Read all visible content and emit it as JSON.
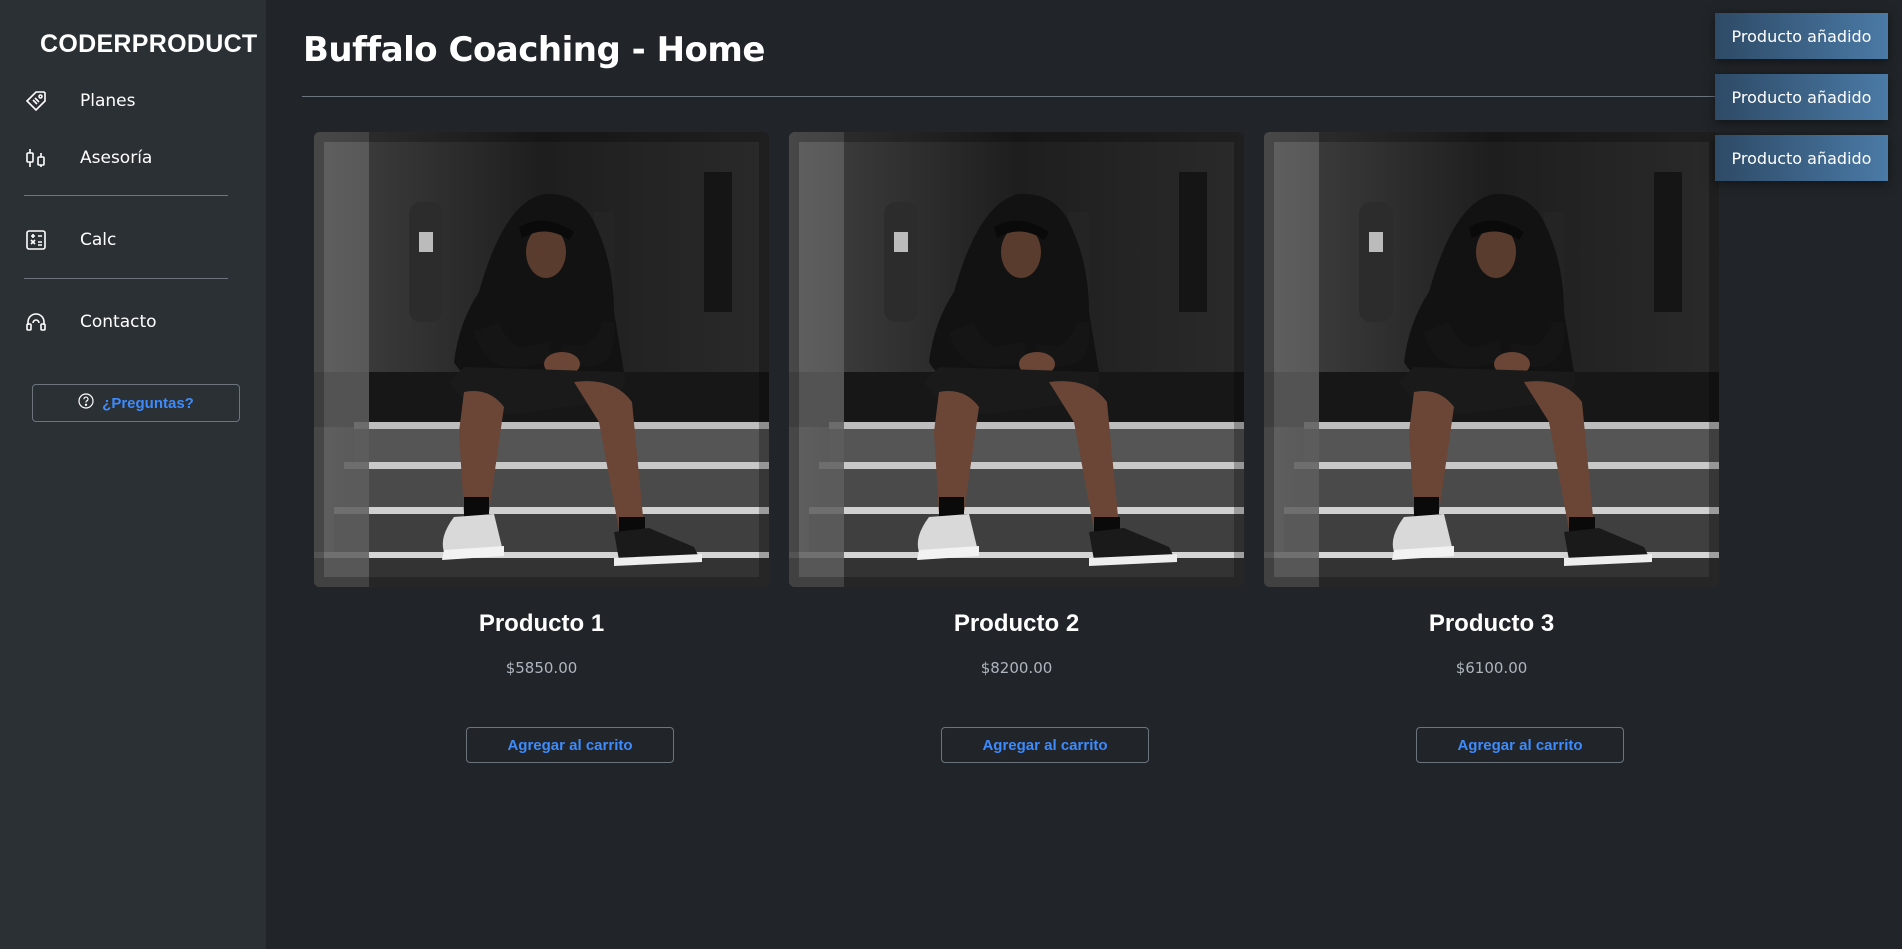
{
  "sidebar": {
    "brand": "CODERPRODUCT",
    "items": [
      {
        "label": "Planes",
        "icon": "tag-icon"
      },
      {
        "label": "Asesoría",
        "icon": "chat-icon"
      },
      {
        "label": "Calc",
        "icon": "calculator-icon"
      },
      {
        "label": "Contacto",
        "icon": "headset-icon"
      }
    ],
    "faq_label": "¿Preguntas?"
  },
  "header": {
    "title": "Buffalo Coaching - Home"
  },
  "products": [
    {
      "name": "Producto 1",
      "price": "$5850.00",
      "button": "Agregar al carrito"
    },
    {
      "name": "Producto 2",
      "price": "$8200.00",
      "button": "Agregar al carrito"
    },
    {
      "name": "Producto 3",
      "price": "$6100.00",
      "button": "Agregar al carrito"
    }
  ],
  "toasts": [
    "Producto añadido",
    "Producto añadido",
    "Producto añadido"
  ],
  "colors": {
    "background": "#212529",
    "sidebar": "#2b3035",
    "accent": "#3d8bfd",
    "border": "#6c757d",
    "toast": "#3b5f82"
  }
}
